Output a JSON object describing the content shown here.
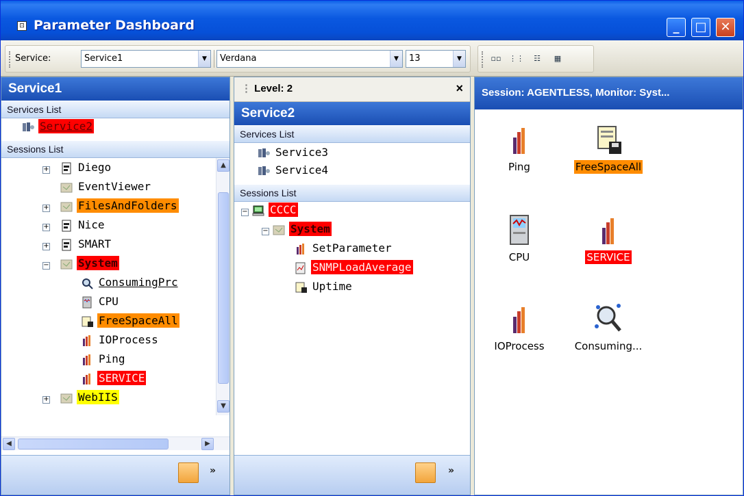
{
  "window": {
    "title": "Parameter Dashboard",
    "icon": "app-icon",
    "controls": [
      "minimize",
      "maximize",
      "close"
    ]
  },
  "toolbar": {
    "service_label": "Service:",
    "service_value": "Service1",
    "font_value": "Verdana",
    "size_value": "13",
    "format_buttons": [
      "view-small-icons",
      "view-list",
      "view-details",
      "view-grid"
    ]
  },
  "left_pane": {
    "title": "Service1",
    "services_header": "Services List",
    "services": [
      {
        "label": "Service2",
        "highlight": "red",
        "underline": true
      }
    ],
    "sessions_header": "Sessions List",
    "sessions": [
      {
        "label": "Diego",
        "level": 0,
        "expander": "+",
        "highlight": "none"
      },
      {
        "label": "EventViewer",
        "level": 0,
        "expander": "",
        "highlight": "none"
      },
      {
        "label": "FilesAndFolders",
        "level": 0,
        "expander": "+",
        "highlight": "orange"
      },
      {
        "label": "Nice",
        "level": 0,
        "expander": "+",
        "highlight": "none"
      },
      {
        "label": "SMART",
        "level": 0,
        "expander": "+",
        "highlight": "none"
      },
      {
        "label": "System",
        "level": 0,
        "expander": "-",
        "highlight": "red",
        "bold": true
      },
      {
        "label": "ConsumingPrc",
        "level": 1,
        "highlight": "none",
        "underline": true
      },
      {
        "label": "CPU",
        "level": 1,
        "highlight": "none"
      },
      {
        "label": "FreeSpaceAll",
        "level": 1,
        "highlight": "orange"
      },
      {
        "label": "IOProcess",
        "level": 1,
        "highlight": "none"
      },
      {
        "label": "Ping",
        "level": 1,
        "highlight": "none"
      },
      {
        "label": "SERVICE",
        "level": 1,
        "highlight": "red"
      },
      {
        "label": "WebIIS",
        "level": 0,
        "expander": "+",
        "highlight": "yellow"
      }
    ]
  },
  "middle_pane": {
    "level_label": "Level: 2",
    "close_glyph": "×",
    "title": "Service2",
    "services_header": "Services List",
    "services": [
      {
        "label": "Service3"
      },
      {
        "label": "Service4"
      }
    ],
    "sessions_header": "Sessions List",
    "sessions": [
      {
        "label": "CCCC",
        "level": 0,
        "expander": "-",
        "highlight": "red"
      },
      {
        "label": "System",
        "level": 1,
        "expander": "-",
        "highlight": "red",
        "bold": true
      },
      {
        "label": "SetParameter",
        "level": 2,
        "highlight": "none"
      },
      {
        "label": "SNMPLoadAverage",
        "level": 2,
        "highlight": "red"
      },
      {
        "label": "Uptime",
        "level": 2,
        "highlight": "none"
      }
    ]
  },
  "right_pane": {
    "header": "Session: AGENTLESS, Monitor: Syst...",
    "icons": [
      {
        "label": "Ping",
        "highlight": "none",
        "icon": "bars-icon"
      },
      {
        "label": "FreeSpaceAll",
        "highlight": "orange",
        "icon": "disk-db-icon"
      },
      {
        "label": "CPU",
        "highlight": "none",
        "icon": "cpu-icon"
      },
      {
        "label": "SERVICE",
        "highlight": "red",
        "icon": "bars-icon"
      },
      {
        "label": "IOProcess",
        "highlight": "none",
        "icon": "bars-icon"
      },
      {
        "label": "Consuming...",
        "highlight": "none",
        "icon": "magnifier-icon"
      }
    ]
  },
  "colors": {
    "highlight_red": "#ff0000",
    "highlight_orange": "#ff8c00",
    "highlight_yellow": "#ffff00",
    "header_blue": "#1a4eb3"
  }
}
